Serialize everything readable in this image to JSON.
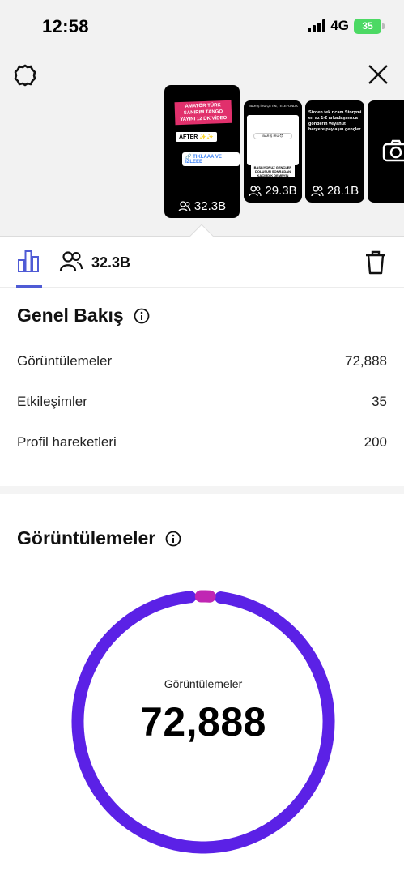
{
  "status_bar": {
    "time": "12:58",
    "network": "4G",
    "battery": "35"
  },
  "stories": [
    {
      "count": "32.3B",
      "pink_text": "AMATÖR TÜRK SANIRIM TANGO YAYINI 12 DK VİDEO",
      "after_text": "AFTER ✨✨",
      "link_text": "🔗 TIKLAAA VE İZLEEE"
    },
    {
      "count": "29.3B",
      "header_text": "BARIŞ İRU ÇETİN, TELEFONDA",
      "mid_text": "BARIŞ İRU 😈",
      "yellow_text": "BAŞLIYORUZ GENÇLER DOLUŞUN SONRADAN KAÇIRDIK DEMEYİN"
    },
    {
      "count": "28.1B",
      "text": "Sizden tek ricam Storymi en az 1-2 arkadaşınızca gönderin veyahut heryere paylaşın gençler"
    },
    {
      "count": ""
    }
  ],
  "tabs": {
    "audience_count": "32.3B"
  },
  "overview": {
    "title": "Genel Bakış",
    "rows": [
      {
        "label": "Görüntülemeler",
        "value": "72,888"
      },
      {
        "label": "Etkileşimler",
        "value": "35"
      },
      {
        "label": "Profil hareketleri",
        "value": "200"
      }
    ]
  },
  "views": {
    "title": "Görüntülemeler",
    "ring_label": "Görüntülemeler",
    "ring_value": "72,888",
    "ring_color": "#5b21e6",
    "accent_color": "#c026b3"
  }
}
